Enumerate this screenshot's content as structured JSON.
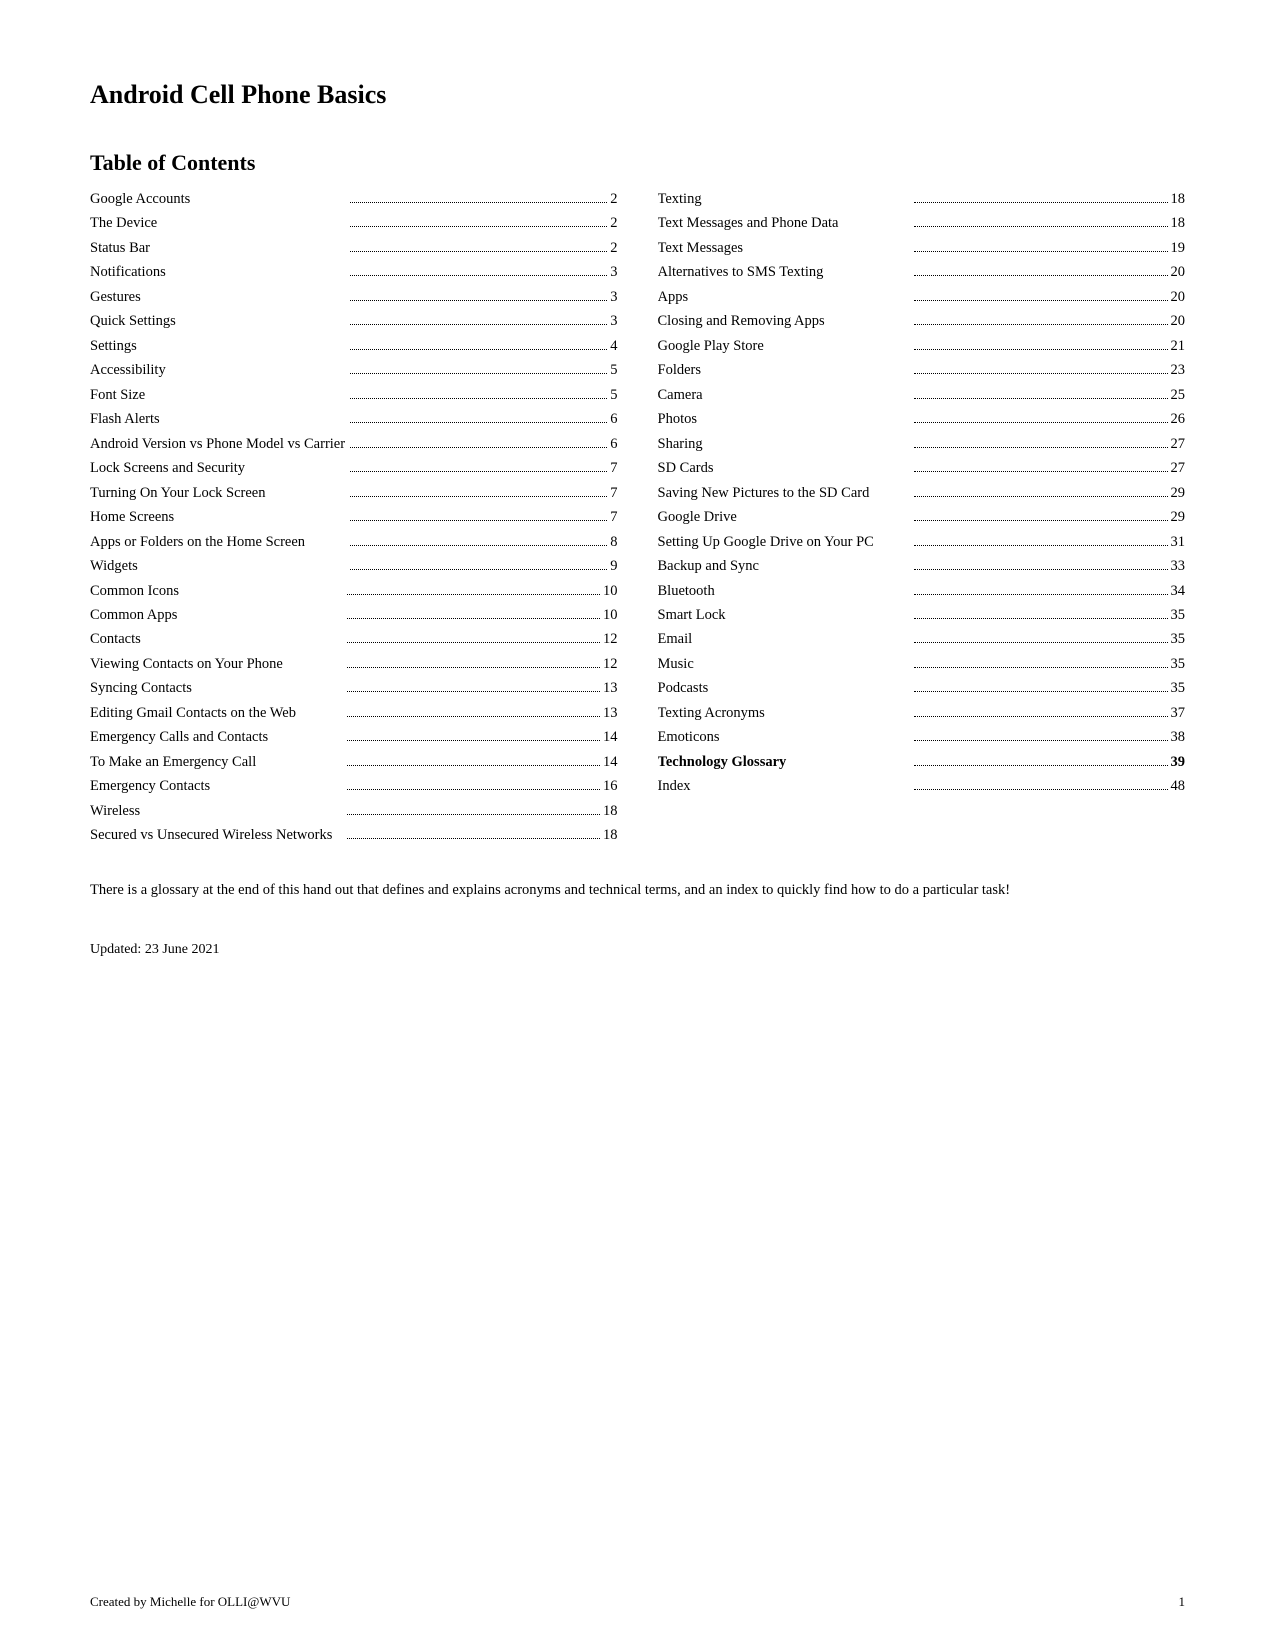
{
  "page": {
    "title": "Android Cell Phone Basics",
    "toc_heading": "Table of Contents",
    "note": "There is a glossary at the end of this hand out that defines and explains acronyms and technical terms, and an index to quickly find how to do a particular task!",
    "updated": "Updated: 23 June 2021",
    "footer_left": "Created by Michelle for OLLI@WVU",
    "footer_right": "1"
  },
  "toc_left": [
    {
      "label": "Google Accounts",
      "page": "2",
      "bold": false
    },
    {
      "label": "The Device",
      "page": "2",
      "bold": false
    },
    {
      "label": "Status Bar",
      "page": "2",
      "bold": false
    },
    {
      "label": "Notifications",
      "page": "3",
      "bold": false
    },
    {
      "label": "Gestures",
      "page": "3",
      "bold": false
    },
    {
      "label": "Quick Settings",
      "page": "3",
      "bold": false
    },
    {
      "label": "Settings",
      "page": "4",
      "bold": false
    },
    {
      "label": "Accessibility",
      "page": "5",
      "bold": false
    },
    {
      "label": "Font Size",
      "page": "5",
      "bold": false
    },
    {
      "label": "Flash Alerts",
      "page": "6",
      "bold": false
    },
    {
      "label": "Android Version vs Phone Model vs Carrier",
      "page": "6",
      "bold": false
    },
    {
      "label": "Lock Screens and Security",
      "page": "7",
      "bold": false
    },
    {
      "label": "Turning On Your Lock Screen",
      "page": "7",
      "bold": false
    },
    {
      "label": "Home Screens",
      "page": "7",
      "bold": false
    },
    {
      "label": "Apps or Folders on the Home Screen",
      "page": "8",
      "bold": false
    },
    {
      "label": "Widgets",
      "page": "9",
      "bold": false
    },
    {
      "label": "Common Icons",
      "page": "10",
      "bold": false
    },
    {
      "label": "Common Apps",
      "page": "10",
      "bold": false
    },
    {
      "label": "Contacts",
      "page": "12",
      "bold": false
    },
    {
      "label": "Viewing Contacts on Your Phone",
      "page": "12",
      "bold": false
    },
    {
      "label": "Syncing Contacts",
      "page": "13",
      "bold": false
    },
    {
      "label": "Editing Gmail Contacts on the Web",
      "page": "13",
      "bold": false
    },
    {
      "label": "Emergency Calls and Contacts",
      "page": "14",
      "bold": false
    },
    {
      "label": "To Make an Emergency Call",
      "page": "14",
      "bold": false
    },
    {
      "label": "Emergency Contacts",
      "page": "16",
      "bold": false
    },
    {
      "label": "Wireless",
      "page": "18",
      "bold": false
    },
    {
      "label": "Secured vs Unsecured Wireless Networks",
      "page": "18",
      "bold": false
    }
  ],
  "toc_right": [
    {
      "label": "Texting",
      "page": "18",
      "bold": false
    },
    {
      "label": "Text Messages and Phone Data",
      "page": "18",
      "bold": false
    },
    {
      "label": "Text Messages",
      "page": "19",
      "bold": false
    },
    {
      "label": "Alternatives to SMS Texting",
      "page": "20",
      "bold": false
    },
    {
      "label": "Apps",
      "page": "20",
      "bold": false
    },
    {
      "label": "Closing and Removing Apps",
      "page": "20",
      "bold": false
    },
    {
      "label": "Google Play Store",
      "page": "21",
      "bold": false
    },
    {
      "label": "Folders",
      "page": "23",
      "bold": false
    },
    {
      "label": "Camera",
      "page": "25",
      "bold": false
    },
    {
      "label": "Photos",
      "page": "26",
      "bold": false
    },
    {
      "label": "Sharing",
      "page": "27",
      "bold": false
    },
    {
      "label": "SD Cards",
      "page": "27",
      "bold": false
    },
    {
      "label": "Saving New Pictures to the SD Card",
      "page": "29",
      "bold": false
    },
    {
      "label": "Google Drive",
      "page": "29",
      "bold": false
    },
    {
      "label": "Setting Up Google Drive on Your PC",
      "page": "31",
      "bold": false
    },
    {
      "label": "Backup and Sync",
      "page": "33",
      "bold": false
    },
    {
      "label": "Bluetooth",
      "page": "34",
      "bold": false
    },
    {
      "label": "Smart Lock",
      "page": "35",
      "bold": false
    },
    {
      "label": "Email",
      "page": "35",
      "bold": false
    },
    {
      "label": "Music",
      "page": "35",
      "bold": false
    },
    {
      "label": "Podcasts",
      "page": "35",
      "bold": false
    },
    {
      "label": "Texting Acronyms",
      "page": "37",
      "bold": false
    },
    {
      "label": "Emoticons",
      "page": "38",
      "bold": false
    },
    {
      "label": "Technology Glossary",
      "page": "39",
      "bold": true
    },
    {
      "label": "Index",
      "page": "48",
      "bold": false
    }
  ]
}
